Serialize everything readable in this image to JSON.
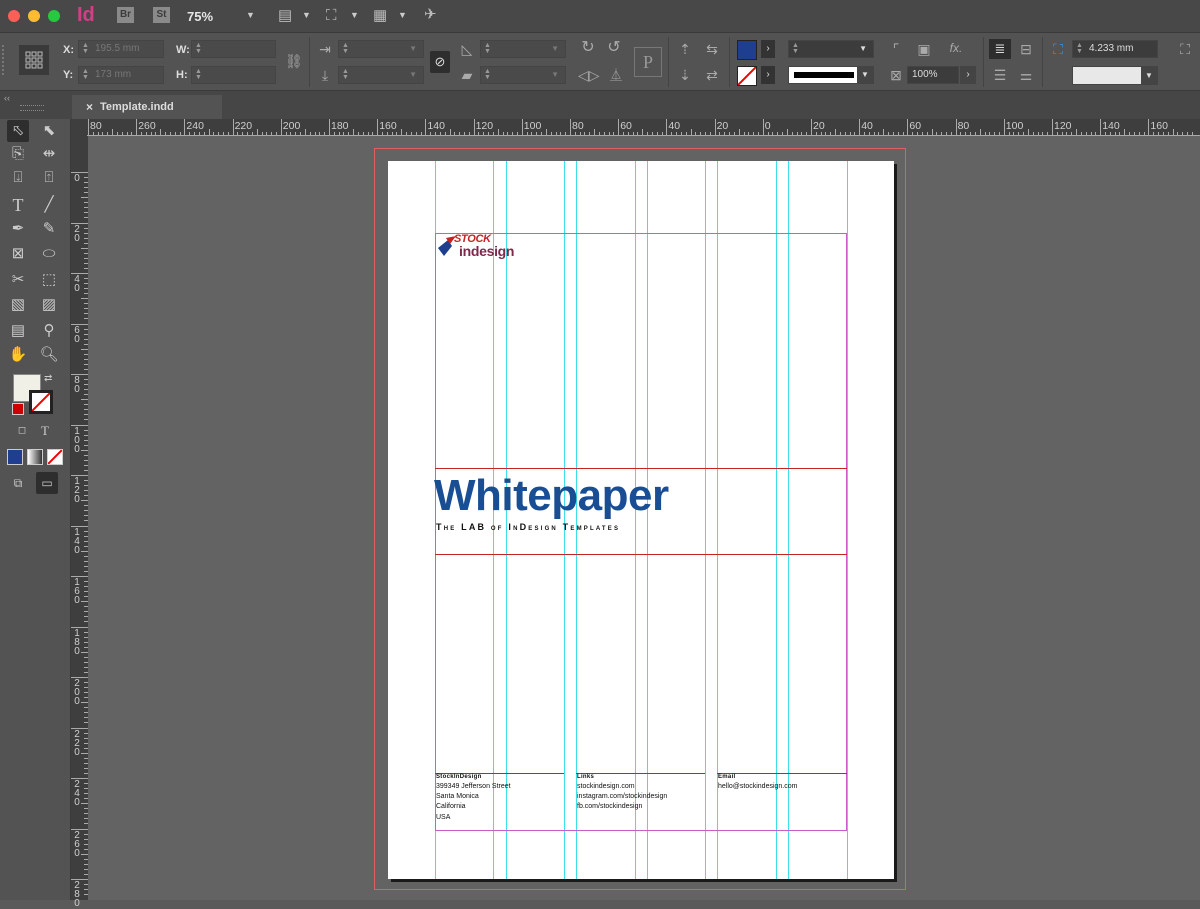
{
  "app": {
    "app_icon": "Id",
    "bridge_label": "Br",
    "stock_label": "St",
    "zoom": "75%"
  },
  "control": {
    "x_label": "X:",
    "x_value": "195.5 mm",
    "y_label": "Y:",
    "y_value": "173 mm",
    "w_label": "W:",
    "h_label": "H:",
    "opacity": "100%",
    "stroke_weight": "4.233 mm",
    "fill_color": "#1f3e8f"
  },
  "tab": {
    "close": "×",
    "title": "Template.indd"
  },
  "rulers": {
    "h": [
      "80",
      "260",
      "240",
      "220",
      "200",
      "180",
      "160",
      "140",
      "120",
      "100",
      "80",
      "60",
      "40",
      "20",
      "0",
      "20",
      "40",
      "60",
      "80",
      "100",
      "120",
      "140",
      "160"
    ],
    "v": [
      "0",
      "20",
      "40",
      "60",
      "80",
      "100",
      "120",
      "140",
      "160",
      "180",
      "200",
      "220",
      "240",
      "260",
      "280"
    ]
  },
  "document": {
    "logo_top": "STOCK",
    "logo_bottom": "indesign",
    "title": "Whitepaper",
    "subtitle": "The LAB of InDesign Templates",
    "footer": {
      "col1": {
        "heading": "StockInDesign",
        "lines": [
          "399349 Jefferson Street",
          "Santa Monica",
          "California",
          "USA"
        ]
      },
      "col2": {
        "heading": "Links",
        "lines": [
          "stockindesign.com",
          "instagram.com/stockindesign",
          "fb.com/stockindesign"
        ]
      },
      "col3": {
        "heading": "Email",
        "lines": [
          "hello@stockindesign.com"
        ]
      }
    }
  },
  "colors": {
    "title_blue": "#1a4e94",
    "guide_cyan": "#3de0e8",
    "margin_magenta": "#c85cc8",
    "rule_red": "#c42424"
  }
}
